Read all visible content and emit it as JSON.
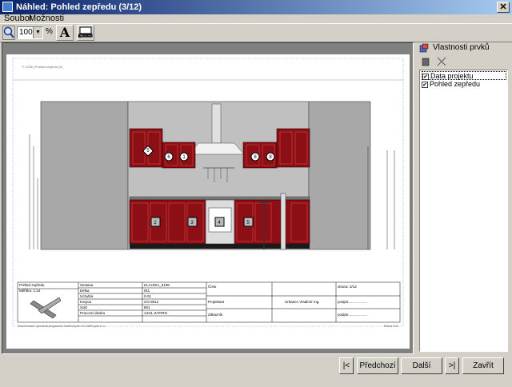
{
  "window": {
    "title": "Náhled: Pohled zepředu (3/12)",
    "close_symbol": "✕"
  },
  "menu": {
    "items": [
      "Soubor",
      "Možnosti"
    ]
  },
  "toolbar": {
    "zoom_value": "100",
    "zoom_unit": "%",
    "text_tool": "A",
    "button_label": "◣ RAD"
  },
  "drawing": {
    "header_left": "F-1238 | Pohled zepředu (3)",
    "cabinet_tags": [
      "5",
      "6",
      "1",
      "8",
      "8"
    ],
    "base_tags": [
      "2",
      "3",
      "4",
      "5"
    ],
    "info_table": {
      "r1": [
        "Pohled zepředu",
        "Sestava",
        "KLAUDIA_0138",
        "Číslo",
        "strana: 3/12"
      ],
      "r2": [
        "Měřítko: 1:24",
        "Délka",
        "911"
      ],
      "r3": [
        "Úchytka",
        "0-01"
      ],
      "r4": [
        "Korpus",
        "CO-9012",
        "Projektant",
        "Urbanec Vladimír Ing.",
        "podpis:.................."
      ],
      "r5": [
        "Sokl",
        "801"
      ],
      "r6": [
        "Pracovní deska",
        "AZUL ZAFIRO"
      ],
      "r7": [
        "Zákazník",
        "podpis:.................."
      ]
    },
    "footer_left": "Dokumentace vytvořena programem CadKuchyně 4.5 CadProjekt s.r.o.",
    "footer_right": "Strana 3/12"
  },
  "properties_panel": {
    "title": "Vlastnosti prvků",
    "items": [
      {
        "label": "Data projektu",
        "checked": true
      },
      {
        "label": "Pohled zepředu",
        "checked": true
      }
    ]
  },
  "buttons": {
    "first": "|<",
    "prev": "Předchozí",
    "next": "Další",
    "last": ">|",
    "close": "Zavřít"
  },
  "colors": {
    "cabinet": "#8b0f14",
    "wall": "#a8a8a8",
    "accent": "#0a246a"
  }
}
